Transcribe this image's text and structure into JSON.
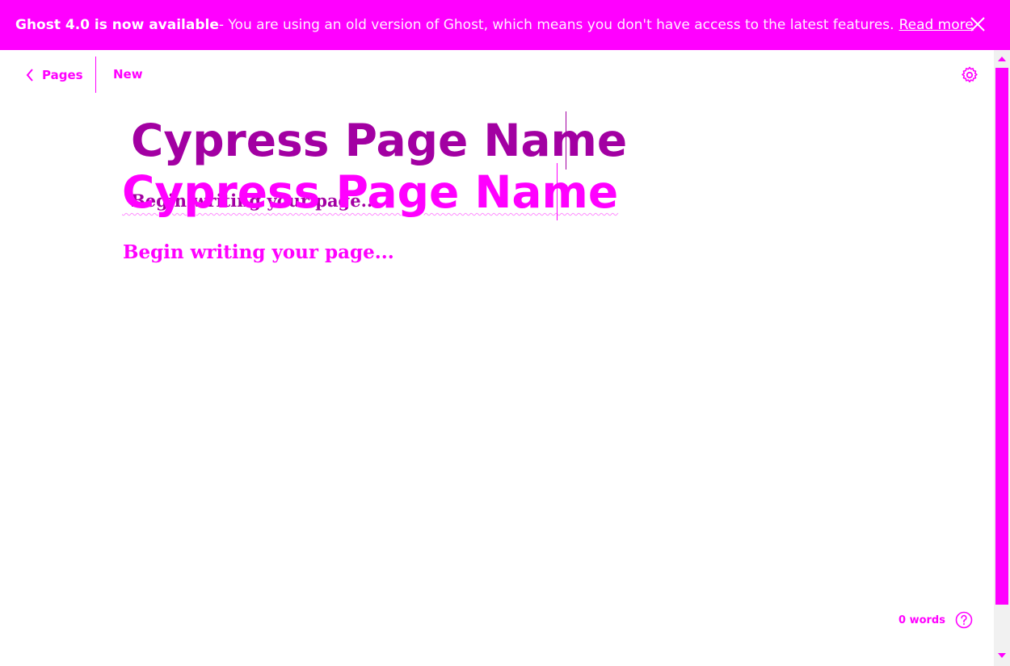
{
  "banner": {
    "title": "Ghost 4.0 is now available",
    "message": " - You are using an old version of Ghost, which means you don't have access to the latest features.",
    "link": "Read more"
  },
  "header": {
    "back_label": "Pages",
    "status": "New"
  },
  "editor": {
    "title": "Cypress Page Name",
    "body_placeholder": "Begin writing your page..."
  },
  "footer": {
    "word_count": "0 words"
  },
  "colors": {
    "accent": "#ff00ff",
    "ghost": "#a200a2"
  }
}
